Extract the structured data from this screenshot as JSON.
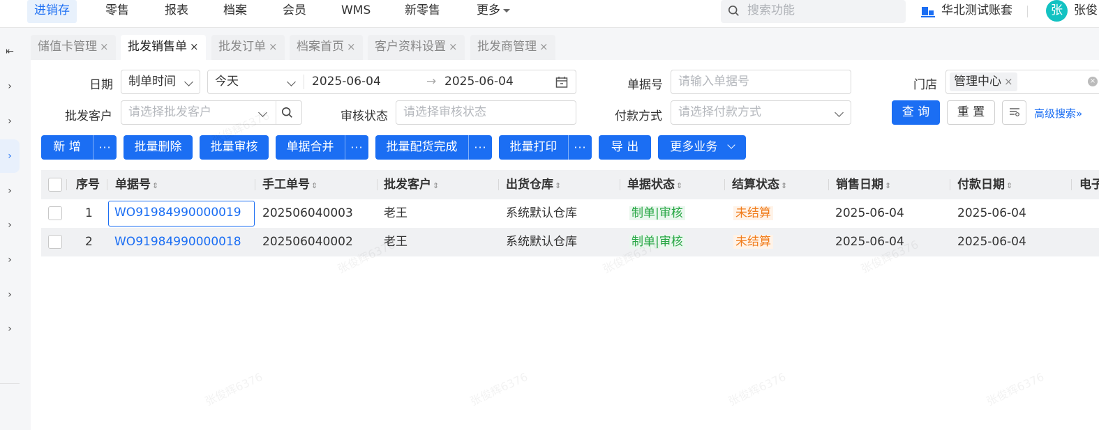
{
  "topnav": {
    "items": [
      "进销存",
      "零售",
      "报表",
      "档案",
      "会员",
      "WMS",
      "新零售",
      "更多"
    ],
    "search_placeholder": "搜索功能",
    "account_name": "华北测试账套",
    "avatar_char": "张",
    "username": "张俊"
  },
  "tabs": [
    {
      "label": "储值卡管理"
    },
    {
      "label": "批发销售单"
    },
    {
      "label": "批发订单"
    },
    {
      "label": "档案首页"
    },
    {
      "label": "客户资料设置"
    },
    {
      "label": "批发商管理"
    }
  ],
  "tab_close": "×",
  "filters": {
    "date_label": "日期",
    "date_type": "制单时间",
    "date_range_preset": "今天",
    "date_start": "2025-06-04",
    "date_arrow": "→",
    "date_end": "2025-06-04",
    "doc_no_label": "单据号",
    "doc_no_placeholder": "请输入单据号",
    "store_label": "门店",
    "store_chip": "管理中心",
    "customer_label": "批发客户",
    "customer_placeholder": "请选择批发客户",
    "audit_label": "审核状态",
    "audit_placeholder": "请选择审核状态",
    "pay_label": "付款方式",
    "pay_placeholder": "请选择付款方式",
    "query": "查 询",
    "reset": "重 置",
    "advanced": "高级搜索"
  },
  "actions": {
    "add": "新 增",
    "batch_delete": "批量删除",
    "batch_audit": "批量审核",
    "merge": "单据合并",
    "batch_stock": "批量配货完成",
    "batch_print": "批量打印",
    "export": "导 出",
    "more_business": "更多业务",
    "dots": "···"
  },
  "table": {
    "columns": [
      "序号",
      "单据号",
      "手工单号",
      "批发客户",
      "出货仓库",
      "单据状态",
      "结算状态",
      "销售日期",
      "付款日期",
      "电子"
    ],
    "rows": [
      {
        "seq": "1",
        "doc_no": "WO91984990000019",
        "manual_no": "202506040003",
        "customer": "老王",
        "warehouse": "系统默认仓库",
        "doc_status": "制单|审核",
        "settle_status": "未结算",
        "sale_date": "2025-06-04",
        "pay_date": "2025-06-04"
      },
      {
        "seq": "2",
        "doc_no": "WO91984990000018",
        "manual_no": "202506040002",
        "customer": "老王",
        "warehouse": "系统默认仓库",
        "doc_status": "制单|审核",
        "settle_status": "未结算",
        "sale_date": "2025-06-04",
        "pay_date": "2025-06-04"
      }
    ]
  },
  "watermark": "张俊辉6376",
  "colors": {
    "primary": "#1b6ef3",
    "success": "#28a745",
    "warning": "#f07c1b",
    "avatar": "#13c2c2"
  }
}
